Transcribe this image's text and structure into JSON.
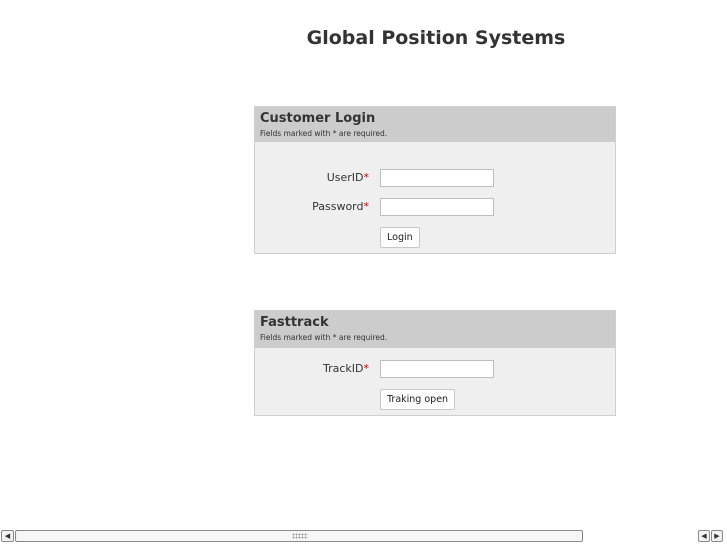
{
  "page": {
    "title": "Global Position Systems"
  },
  "login_panel": {
    "title": "Customer Login",
    "note": "Fields marked with * are required.",
    "userid_label": "UserID",
    "password_label": "Password",
    "required_mark": "*",
    "userid_value": "",
    "password_value": "",
    "button_label": "Login"
  },
  "fasttrack_panel": {
    "title": "Fasttrack",
    "note": "Fields marked with * are required.",
    "trackid_label": "TrackID",
    "required_mark": "*",
    "trackid_value": "",
    "button_label": "Traking open"
  },
  "scrollbar": {
    "left_icon": "arrow-left-icon",
    "right_icon": "arrow-right-icon",
    "left_glyph": "◀",
    "right_glyph": "▶"
  }
}
